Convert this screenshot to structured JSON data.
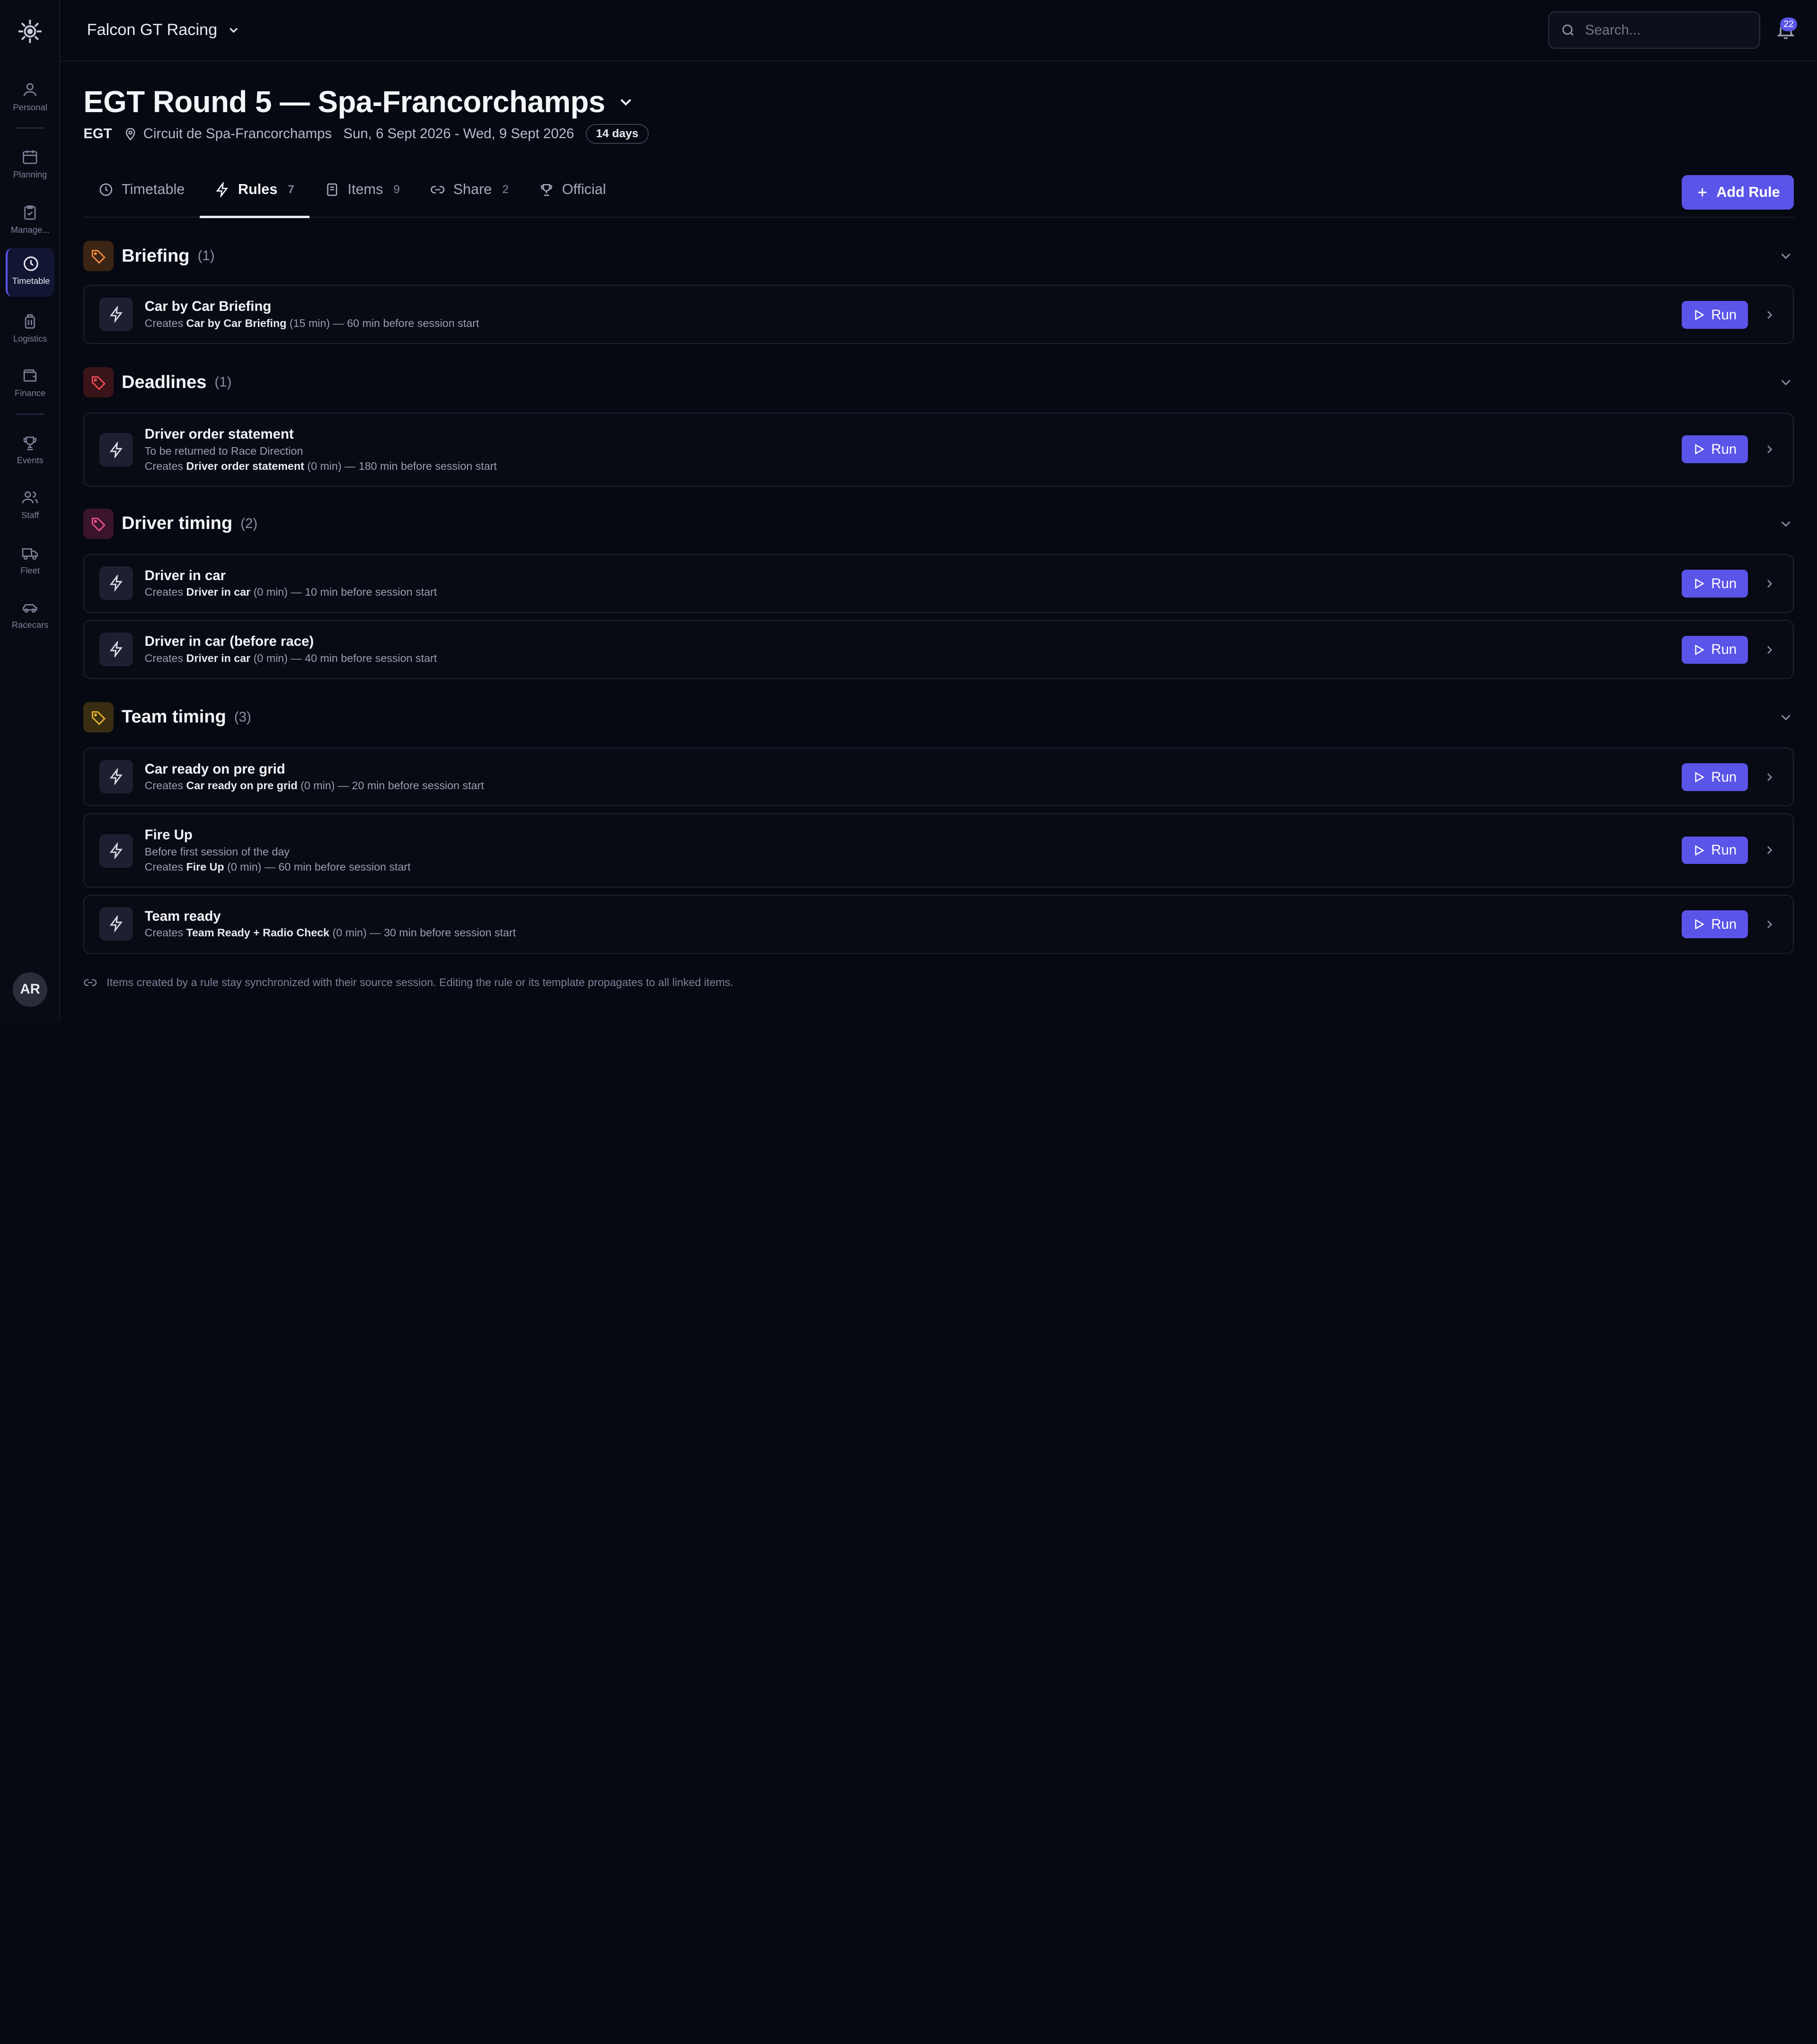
{
  "org": {
    "name": "Falcon GT Racing"
  },
  "search": {
    "placeholder": "Search..."
  },
  "notifications": {
    "count": "22"
  },
  "user": {
    "initials": "AR"
  },
  "sidebar": {
    "items": [
      {
        "label": "Personal",
        "icon": "person-icon"
      },
      {
        "label": "Planning",
        "icon": "calendar-icon"
      },
      {
        "label": "Manage...",
        "icon": "clipboard-check-icon"
      },
      {
        "label": "Timetable",
        "icon": "clock-icon"
      },
      {
        "label": "Logistics",
        "icon": "luggage-icon"
      },
      {
        "label": "Finance",
        "icon": "wallet-icon"
      },
      {
        "label": "Events",
        "icon": "trophy-icon"
      },
      {
        "label": "Staff",
        "icon": "users-icon"
      },
      {
        "label": "Fleet",
        "icon": "truck-icon"
      },
      {
        "label": "Racecars",
        "icon": "car-icon"
      }
    ]
  },
  "event": {
    "title": "EGT Round 5 — Spa-Francorchamps",
    "series": "EGT",
    "location": "Circuit de Spa-Francorchamps",
    "dates": "Sun, 6 Sept 2026 - Wed, 9 Sept 2026",
    "duration": "14 days"
  },
  "tabs": [
    {
      "label": "Timetable",
      "count": ""
    },
    {
      "label": "Rules",
      "count": "7"
    },
    {
      "label": "Items",
      "count": "9"
    },
    {
      "label": "Share",
      "count": "2"
    },
    {
      "label": "Official",
      "count": ""
    }
  ],
  "actions": {
    "add_rule": "Add Rule",
    "run": "Run"
  },
  "groups": [
    {
      "name": "Briefing",
      "count": "(1)",
      "color": "#f08a3c",
      "rules": [
        {
          "name": "Car by Car Briefing",
          "desc": "",
          "creates_prefix": "Creates ",
          "creates_item": "Car by Car Briefing",
          "creates_suffix": " (15 min) — 60 min before session start"
        }
      ]
    },
    {
      "name": "Deadlines",
      "count": "(1)",
      "color": "#ef4d5a",
      "rules": [
        {
          "name": "Driver order statement",
          "desc": "To be returned to Race Direction",
          "creates_prefix": "Creates ",
          "creates_item": "Driver order statement",
          "creates_suffix": " (0 min) — 180 min before session start"
        }
      ]
    },
    {
      "name": "Driver timing",
      "count": "(2)",
      "color": "#e9508a",
      "rules": [
        {
          "name": "Driver in car",
          "desc": "",
          "creates_prefix": "Creates ",
          "creates_item": "Driver in car",
          "creates_suffix": " (0 min) — 10 min before session start"
        },
        {
          "name": "Driver in car (before race)",
          "desc": "",
          "creates_prefix": "Creates ",
          "creates_item": "Driver in car",
          "creates_suffix": " (0 min) — 40 min before session start"
        }
      ]
    },
    {
      "name": "Team timing",
      "count": "(3)",
      "color": "#e6b22e",
      "rules": [
        {
          "name": "Car ready on pre grid",
          "desc": "",
          "creates_prefix": "Creates ",
          "creates_item": "Car ready on pre grid",
          "creates_suffix": " (0 min) — 20 min before session start"
        },
        {
          "name": "Fire Up",
          "desc": "Before first session of the day",
          "creates_prefix": "Creates ",
          "creates_item": "Fire Up",
          "creates_suffix": " (0 min) — 60 min before session start"
        },
        {
          "name": "Team ready",
          "desc": "",
          "creates_prefix": "Creates ",
          "creates_item": "Team Ready + Radio Check",
          "creates_suffix": " (0 min) — 30 min before session start"
        }
      ]
    }
  ],
  "footer": {
    "note": "Items created by a rule stay synchronized with their source session. Editing the rule or its template propagates to all linked items."
  }
}
